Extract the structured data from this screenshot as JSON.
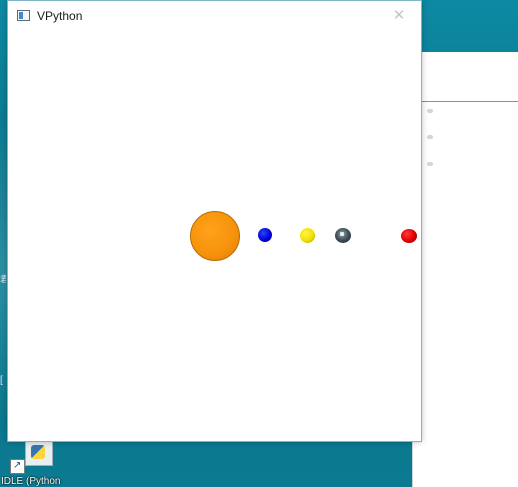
{
  "window": {
    "title": "VPython",
    "close_symbol": "✕",
    "icon": "vpython-window-icon"
  },
  "scene": {
    "background": "#ffffff",
    "bodies": [
      {
        "name": "sun",
        "color": "#f7930c"
      },
      {
        "name": "blue-planet",
        "color": "#0000d8"
      },
      {
        "name": "yellow-planet",
        "color": "#f0e000"
      },
      {
        "name": "grey-planet",
        "color": "#3f4e57"
      },
      {
        "name": "red-planet",
        "color": "#e00000"
      }
    ]
  },
  "desktop": {
    "icon_label": "IDLE (Python",
    "left_glyph_1": "君",
    "left_glyph_2": "[",
    "shortcut_arrow": "↗",
    "accent": "#0b7e95"
  }
}
